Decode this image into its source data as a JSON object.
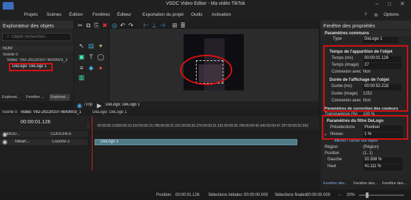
{
  "app": {
    "window_title": "VSDC Video Editor - Ma vidéo TikTok",
    "options_label": "Options",
    "menu": [
      "Projets",
      "Scènes",
      "Édition",
      "Fenêtres",
      "Éditeur",
      "Exportation du projet",
      "Outils",
      "Activation"
    ]
  },
  "object_explorer": {
    "title": "Explorateur des objets",
    "search_placeholder": "Objets recherchés",
    "column_header": "NOM",
    "tree": [
      "Scene 0",
      "Vidéo: VID-20220107-WA0003_1",
      "DeLogo: DeLogo 1"
    ],
    "bottom_tabs": [
      "Explorat...",
      "Fenêtre ...",
      "Explorat..."
    ]
  },
  "preview": {
    "zoom_label": "720p",
    "tab_label": "DeLogo: DeLogo 1"
  },
  "timeline": {
    "tabs": [
      "Scene 0",
      "Vidéo: VID-20220107-WA0003_1",
      "DeLogo: DeLogo 1"
    ],
    "current_time": "00:00:01.126",
    "ticks": [
      "00:00:05.215",
      "00:00:10.510",
      "00:00:15.785",
      "00:00:21.021",
      "00:00:26.276",
      "00:00:31.531",
      "00:00:36.786",
      "00:00:42.042",
      "00:00:47.297",
      "00:00:52.552",
      "00:00:57.807",
      "00:01:03.063"
    ],
    "track_header_mod": "MOD...",
    "track_header_layers": "COUCHES",
    "track_row_blend": "Mélan...",
    "track_row_layer": "Couche 2",
    "clip_label": "DeLogo 1"
  },
  "properties": {
    "title": "Fenêtre des propriétés",
    "common_section": "Paramètres communs",
    "type_label": "Type",
    "type_value": "DeLogo 1",
    "appear_section": "Temps de l'apparition de l'objet",
    "time_ms_label": "Temps (ms)",
    "time_ms_value": "00:00:01.126",
    "time_frame_label": "Temps (image)",
    "time_frame_value": "27",
    "connect_label": "Connexion avec",
    "connect_value": "Non",
    "duration_section": "Durée de l'affichage de l'objet",
    "duration_ms_label": "Durée (ms)",
    "duration_ms_value": "00:00:52.218",
    "duration_frame_label": "Durée (image)",
    "duration_frame_value": "1252",
    "connect2_label": "Connexion avec",
    "connect2_value": "Non",
    "color_section": "Paramètres de correction des couleurs",
    "transparency_label": "Transparence (%)",
    "transparency_value": "100 %",
    "filter_section": "Paramètres du filtre DeLogo",
    "preset_label": "Présélections",
    "preset_value": "Pixeliser",
    "level_label": "Niveau",
    "level_value": "1 %",
    "tooltip": "Afficher / cacher une région",
    "region_label": "Région",
    "region_value": "(Région)",
    "position_label": "Position",
    "position_value": "(1, 1)",
    "left_label": "Gauche",
    "left_value": "20.308 %",
    "top_label": "Haut",
    "top_value": "41.111 %",
    "bottom_tabs": [
      "Fenêtre des...",
      "Fenêtre des...",
      "Fenêtre des..."
    ]
  },
  "status": {
    "position_label": "Position:",
    "position_value": "00:00:01.126",
    "start_sel_label": "Sélections initiales:",
    "start_sel_value": "00:00:00.000",
    "end_sel_label": "Sélections finales:",
    "end_sel_value": "00:00:00.000",
    "zoom_value": "20%"
  },
  "colors": {
    "highlight": "#d11111",
    "clip": "#4f7a88",
    "playhead": "#d02020"
  }
}
